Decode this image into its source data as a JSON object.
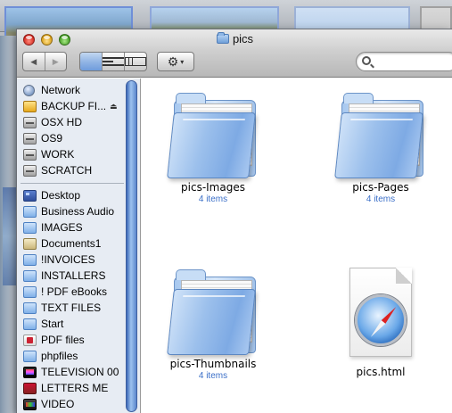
{
  "window": {
    "title": "pics"
  },
  "toolbar": {
    "back_label": "◀",
    "forward_label": "▶",
    "action_label": "⚙",
    "action_caret": "▾",
    "search_value": ""
  },
  "sidebar": {
    "devices": [
      {
        "label": "Network",
        "icon": "network-icon"
      },
      {
        "label": "BACKUP FI...",
        "icon": "external-drive-icon",
        "eject": "⏏"
      },
      {
        "label": "OSX HD",
        "icon": "hard-disk-icon"
      },
      {
        "label": "OS9",
        "icon": "hard-disk-icon"
      },
      {
        "label": "WORK",
        "icon": "hard-disk-icon"
      },
      {
        "label": "SCRATCH",
        "icon": "hard-disk-icon"
      }
    ],
    "places": [
      {
        "label": "Desktop",
        "icon": "desktop-icon"
      },
      {
        "label": "Business Audio",
        "icon": "folder-icon"
      },
      {
        "label": "IMAGES",
        "icon": "folder-icon"
      },
      {
        "label": "Documents1",
        "icon": "documents-folder-icon"
      },
      {
        "label": "!INVOICES",
        "icon": "folder-icon"
      },
      {
        "label": "INSTALLERS",
        "icon": "folder-icon"
      },
      {
        "label": "! PDF eBooks",
        "icon": "folder-icon"
      },
      {
        "label": "TEXT FILES",
        "icon": "folder-icon"
      },
      {
        "label": "Start",
        "icon": "folder-icon"
      },
      {
        "label": "PDF files",
        "icon": "pdf-icon"
      },
      {
        "label": "phpfiles",
        "icon": "folder-icon"
      },
      {
        "label": "TELEVISION 00",
        "icon": "tv-icon"
      },
      {
        "label": "LETTERS ME",
        "icon": "letters-icon"
      },
      {
        "label": "VIDEO",
        "icon": "video-icon"
      }
    ]
  },
  "files": [
    {
      "name": "pics-Images",
      "count": "4 items",
      "kind": "folder"
    },
    {
      "name": "pics-Pages",
      "count": "4 items",
      "kind": "folder"
    },
    {
      "name": "pics-Thumbnails",
      "count": "4 items",
      "kind": "folder"
    },
    {
      "name": "pics.html",
      "count": "",
      "kind": "html-document"
    }
  ]
}
